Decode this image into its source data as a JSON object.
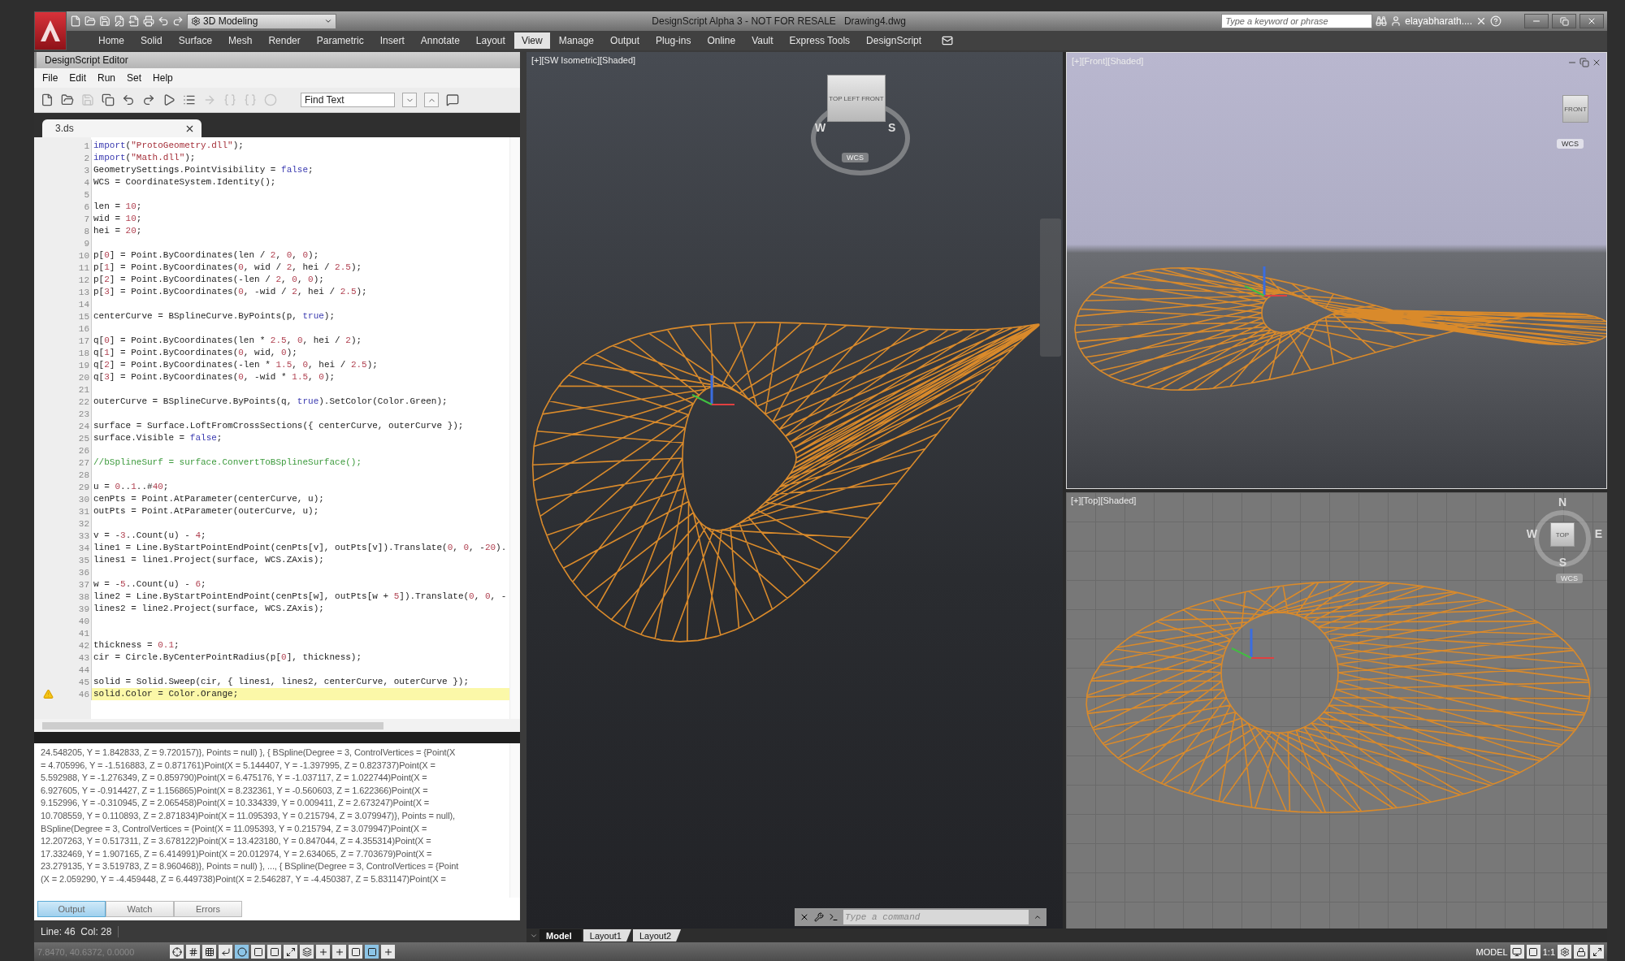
{
  "app": {
    "workspace": "3D Modeling",
    "title": "DesignScript Alpha 3 - NOT FOR RESALE",
    "file": "Drawing4.dwg",
    "search_placeholder": "Type a keyword or phrase",
    "user": "elayabharath...."
  },
  "ribbon_tabs": [
    {
      "label": "Home",
      "selected": false
    },
    {
      "label": "Solid",
      "selected": false
    },
    {
      "label": "Surface",
      "selected": false
    },
    {
      "label": "Mesh",
      "selected": false
    },
    {
      "label": "Render",
      "selected": false
    },
    {
      "label": "Parametric",
      "selected": false
    },
    {
      "label": "Insert",
      "selected": false
    },
    {
      "label": "Annotate",
      "selected": false
    },
    {
      "label": "Layout",
      "selected": false
    },
    {
      "label": "View",
      "selected": true
    },
    {
      "label": "Manage",
      "selected": false
    },
    {
      "label": "Output",
      "selected": false
    },
    {
      "label": "Plug-ins",
      "selected": false
    },
    {
      "label": "Online",
      "selected": false
    },
    {
      "label": "Vault",
      "selected": false
    },
    {
      "label": "Express Tools",
      "selected": false
    },
    {
      "label": "DesignScript",
      "selected": false
    }
  ],
  "editor": {
    "title": "DesignScript Editor",
    "menu": [
      "File",
      "Edit",
      "Run",
      "Set",
      "Help"
    ],
    "find_placeholder": "Find Text",
    "tab": "3.ds",
    "lines": [
      {
        "n": "1",
        "code": "import(\"ProtoGeometry.dll\");",
        "current": false,
        "warning": false
      },
      {
        "n": "2",
        "code": "import(\"Math.dll\");",
        "current": false,
        "warning": false
      },
      {
        "n": "3",
        "code": "GeometrySettings.PointVisibility = false;",
        "current": false,
        "warning": false
      },
      {
        "n": "4",
        "code": "WCS = CoordinateSystem.Identity();",
        "current": false,
        "warning": false
      },
      {
        "n": "5",
        "current": false,
        "warning": false
      },
      {
        "n": "6",
        "code": "len = 10;",
        "current": false,
        "warning": false
      },
      {
        "n": "7",
        "code": "wid = 10;",
        "current": false,
        "warning": false
      },
      {
        "n": "8",
        "code": "hei = 20;",
        "current": false,
        "warning": false
      },
      {
        "n": "9",
        "current": false,
        "warning": false
      },
      {
        "n": "10",
        "code": "p[0] = Point.ByCoordinates(len / 2, 0, 0);",
        "current": false,
        "warning": false
      },
      {
        "n": "11",
        "code": "p[1] = Point.ByCoordinates(0, wid / 2, hei / 2.5);",
        "current": false,
        "warning": false
      },
      {
        "n": "12",
        "code": "p[2] = Point.ByCoordinates(-len / 2, 0, 0);",
        "current": false,
        "warning": false
      },
      {
        "n": "13",
        "code": "p[3] = Point.ByCoordinates(0, -wid / 2, hei / 2.5);",
        "current": false,
        "warning": false
      },
      {
        "n": "14",
        "current": false,
        "warning": false
      },
      {
        "n": "15",
        "code": "centerCurve = BSplineCurve.ByPoints(p, true);",
        "current": false,
        "warning": false
      },
      {
        "n": "16",
        "current": false,
        "warning": false
      },
      {
        "n": "17",
        "code": "q[0] = Point.ByCoordinates(len * 2.5, 0, hei / 2);",
        "current": false,
        "warning": false
      },
      {
        "n": "18",
        "code": "q[1] = Point.ByCoordinates(0, wid, 0);",
        "current": false,
        "warning": false
      },
      {
        "n": "19",
        "code": "q[2] = Point.ByCoordinates(-len * 1.5, 0, hei / 2.5);",
        "current": false,
        "warning": false
      },
      {
        "n": "20",
        "code": "q[3] = Point.ByCoordinates(0, -wid * 1.5, 0);",
        "current": false,
        "warning": false
      },
      {
        "n": "21",
        "current": false,
        "warning": false
      },
      {
        "n": "22",
        "code": "outerCurve = BSplineCurve.ByPoints(q, true).SetColor(Color.Green);",
        "current": false,
        "warning": false
      },
      {
        "n": "23",
        "current": false,
        "warning": false
      },
      {
        "n": "24",
        "code": "surface = Surface.LoftFromCrossSections({ centerCurve, outerCurve });",
        "current": false,
        "warning": false
      },
      {
        "n": "25",
        "code": "surface.Visible = false;",
        "current": false,
        "warning": false
      },
      {
        "n": "26",
        "current": false,
        "warning": false
      },
      {
        "n": "27",
        "code": "//bSplineSurf = surface.ConvertToBSplineSurface();",
        "current": false,
        "warning": false
      },
      {
        "n": "28",
        "current": false,
        "warning": false
      },
      {
        "n": "29",
        "code": "u = 0..1..#40;",
        "current": false,
        "warning": false
      },
      {
        "n": "30",
        "code": "cenPts = Point.AtParameter(centerCurve, u);",
        "current": false,
        "warning": false
      },
      {
        "n": "31",
        "code": "outPts = Point.AtParameter(outerCurve, u);",
        "current": false,
        "warning": false
      },
      {
        "n": "32",
        "current": false,
        "warning": false
      },
      {
        "n": "33",
        "code": "v = -3..Count(u) - 4;",
        "current": false,
        "warning": false
      },
      {
        "n": "34",
        "code": "line1 = Line.ByStartPointEndPoint(cenPts[v], outPts[v]).Translate(0, 0, -20).",
        "current": false,
        "warning": false
      },
      {
        "n": "35",
        "code": "lines1 = line1.Project(surface, WCS.ZAxis);",
        "current": false,
        "warning": false
      },
      {
        "n": "36",
        "current": false,
        "warning": false
      },
      {
        "n": "37",
        "code": "w = -5..Count(u) - 6;",
        "current": false,
        "warning": false
      },
      {
        "n": "38",
        "code": "line2 = Line.ByStartPointEndPoint(cenPts[w], outPts[w + 5]).Translate(0, 0, -",
        "current": false,
        "warning": false
      },
      {
        "n": "39",
        "code": "lines2 = line2.Project(surface, WCS.ZAxis);",
        "current": false,
        "warning": false
      },
      {
        "n": "40",
        "current": false,
        "warning": false
      },
      {
        "n": "41",
        "current": false,
        "warning": false
      },
      {
        "n": "42",
        "code": "thickness = 0.1;",
        "current": false,
        "warning": false
      },
      {
        "n": "43",
        "code": "cir = Circle.ByCenterPointRadius(p[0], thickness);",
        "current": false,
        "warning": false
      },
      {
        "n": "44",
        "current": false,
        "warning": false
      },
      {
        "n": "45",
        "code": "solid = Solid.Sweep(cir, { lines1, lines2, centerCurve, outerCurve });",
        "current": false,
        "warning": false
      },
      {
        "n": "46",
        "code": "solid.Color = Color.Orange;",
        "current": true,
        "warning": true
      }
    ],
    "output_lines": [
      "24.548205, Y = 1.842833, Z = 9.720157)}, Points = null) }, { BSpline(Degree = 3, ControlVertices = {Point(X",
      "= 4.705996, Y = -1.516883, Z = 0.871761)Point(X = 5.144407, Y = -1.397995, Z = 0.823737)Point(X =",
      "5.592988, Y = -1.276349, Z = 0.859790)Point(X = 6.475176, Y = -1.037117, Z = 1.022744)Point(X =",
      "6.927605, Y = -0.914427, Z = 1.156865)Point(X = 8.232361, Y = -0.560603, Z = 1.622366)Point(X =",
      "9.152996, Y = -0.310945, Z = 2.065458)Point(X = 10.334339, Y = 0.009411, Z = 2.673247)Point(X =",
      "10.708559, Y = 0.110893, Z = 2.871834)Point(X = 11.095393, Y = 0.215794, Z = 3.079947)}, Points = null),",
      "BSpline(Degree = 3, ControlVertices = {Point(X = 11.095393, Y = 0.215794, Z = 3.079947)Point(X =",
      "12.207263, Y = 0.517311, Z = 3.678122)Point(X = 13.423180, Y = 0.847044, Z = 4.355314)Point(X =",
      "17.332469, Y = 1.907165, Z = 6.414991)Point(X = 20.012974, Y = 2.634065, Z = 7.703679)Point(X =",
      "23.279135, Y = 3.519783, Z = 8.960468)}, Points = null) }, ..., { BSpline(Degree = 3, ControlVertices = {Point",
      "(X = 2.059290, Y = -4.459448, Z = 6.449738)Point(X = 2.546287, Y = -4.450387, Z = 5.831147)Point(X ="
    ],
    "output_tabs": [
      {
        "label": "Output",
        "selected": true
      },
      {
        "label": "Watch",
        "selected": false
      },
      {
        "label": "Errors",
        "selected": false
      }
    ],
    "position": "Line: 46  Col: 28"
  },
  "viewports": [
    {
      "kind": "isometric",
      "label": "[+][SW Isometric][Shaded]",
      "cube_faces": [
        "TOP",
        "LEFT",
        "FRONT"
      ],
      "compass": [
        "W",
        "S"
      ],
      "wcs": "WCS"
    },
    {
      "kind": "front",
      "label": "[+][Front][Shaded]",
      "cube_faces": [
        "FRONT"
      ],
      "wcs": "WCS"
    },
    {
      "kind": "top",
      "label": "[+][Top][Shaded]",
      "cube_faces": [
        "TOP"
      ],
      "compass": [
        "N",
        "W",
        "E",
        "S"
      ],
      "wcs": "WCS"
    }
  ],
  "layout_tabs": [
    {
      "kind": "model",
      "label": "Model",
      "selected": true
    },
    {
      "kind": "layout",
      "label": "Layout1",
      "selected": false
    },
    {
      "kind": "layout",
      "label": "Layout2",
      "selected": false
    }
  ],
  "command_placeholder": "Type a command",
  "status_bar": {
    "coordinates": "7.8470, 40.6372, 0.0000",
    "space": "MODEL",
    "scale": "1:1"
  }
}
